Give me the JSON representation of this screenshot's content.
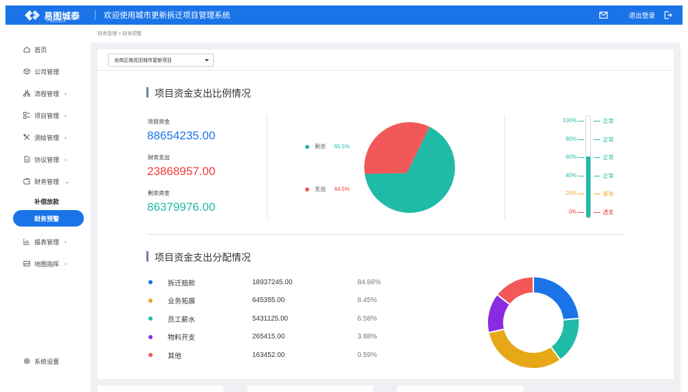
{
  "header": {
    "logo_text": "易图城泰",
    "logo_sub": "产城融合服务商",
    "welcome": "欢迎使用城市更新拆迁项目管理系统",
    "logout": "退出登录",
    "mail_icon": "mail-icon",
    "logout_icon": "logout-icon"
  },
  "sidebar": {
    "items": [
      {
        "label": "首页",
        "icon": "home-icon",
        "chevron": ""
      },
      {
        "label": "公司管理",
        "icon": "cube-icon",
        "chevron": ""
      },
      {
        "label": "流程管理",
        "icon": "flow-icon",
        "chevron": "›"
      },
      {
        "label": "项目管理",
        "icon": "list-icon",
        "chevron": "›"
      },
      {
        "label": "测绘管理",
        "icon": "tools-icon",
        "chevron": "›"
      },
      {
        "label": "协议管理",
        "icon": "document-icon",
        "chevron": "›"
      },
      {
        "label": "财务管理",
        "icon": "wallet-icon",
        "chevron": "⌄"
      }
    ],
    "sub_items": [
      {
        "label": "补偿放款"
      },
      {
        "label": "财务预警"
      }
    ],
    "items_after": [
      {
        "label": "报表管理",
        "icon": "chart-icon",
        "chevron": "›"
      },
      {
        "label": "地图指挥",
        "icon": "map-icon",
        "chevron": "›"
      }
    ],
    "settings": {
      "label": "系统设置",
      "icon": "gear-icon"
    }
  },
  "breadcrumb": "财务管理 > 财务预警",
  "project_select": {
    "value": "龙岗区南花田城市更新项目"
  },
  "ratio_section": {
    "title": "项目资金支出比例情况",
    "stats": [
      {
        "label": "项目资金",
        "value": "88654235.00",
        "color": "#1a74e8"
      },
      {
        "label": "财务支出",
        "value": "23868957.00",
        "color": "#f03a3a"
      },
      {
        "label": "剩余资金",
        "value": "86379976.00",
        "color": "#20bba6"
      }
    ],
    "pie_legend": [
      {
        "label": "剩余",
        "pct": "65.5%",
        "color": "#20bba6"
      },
      {
        "label": "支出",
        "pct": "44.5%",
        "color": "#f25858"
      }
    ],
    "pie": {
      "remaining_fraction": 0.655,
      "color_remaining": "#20bba6",
      "color_spent": "#f25858"
    },
    "gauge": {
      "level": 0.6,
      "color_fill": "#20bba6",
      "ticks": [
        {
          "value": "100%",
          "status": "正常",
          "color": "#20bba6"
        },
        {
          "value": "80%",
          "status": "正常",
          "color": "#20bba6"
        },
        {
          "value": "60%",
          "status": "正常",
          "color": "#20bba6"
        },
        {
          "value": "40%",
          "status": "正常",
          "color": "#20bba6"
        },
        {
          "value": "20%",
          "status": "紧张",
          "color": "#f5a623"
        },
        {
          "value": "0%",
          "status": "透支",
          "color": "#f03a3a"
        }
      ]
    }
  },
  "distribution_section": {
    "title": "项目资金支出分配情况",
    "rows": [
      {
        "name": "拆迁赔款",
        "value": "18937245.00",
        "pct": "84.66%",
        "color": "#1a74e8"
      },
      {
        "name": "业务拓展",
        "value": "645355.00",
        "pct": "8.45%",
        "color": "#e6a817"
      },
      {
        "name": "员工薪水",
        "value": "5431125.00",
        "pct": "6.58%",
        "color": "#20bba6"
      },
      {
        "name": "物料开支",
        "value": "265415.00",
        "pct": "3.88%",
        "color": "#8a2be2"
      },
      {
        "name": "其他",
        "value": "163452.00",
        "pct": "0.59%",
        "color": "#f25858"
      }
    ],
    "donut": [
      {
        "fraction": 0.235,
        "color": "#1a74e8"
      },
      {
        "fraction": 0.165,
        "color": "#20bba6"
      },
      {
        "fraction": 0.315,
        "color": "#e6a817"
      },
      {
        "fraction": 0.14,
        "color": "#8a2be2"
      },
      {
        "fraction": 0.145,
        "color": "#f25858"
      }
    ]
  }
}
